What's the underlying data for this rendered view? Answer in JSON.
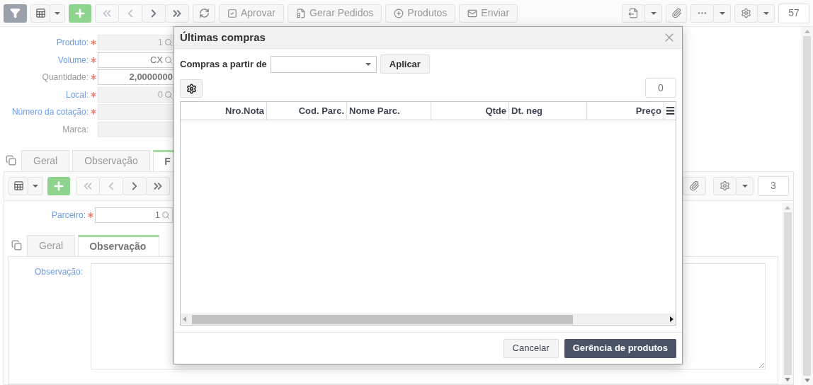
{
  "toolbar": {
    "navigation": [
      {
        "disabled": true
      },
      {
        "disabled": true
      },
      {
        "disabled": false
      },
      {
        "disabled": false
      }
    ],
    "actions": [
      {
        "label": "Aprovar"
      },
      {
        "label": "Gerar Pedidos"
      },
      {
        "label": "Produtos"
      },
      {
        "label": "Enviar"
      }
    ],
    "record_count": "57"
  },
  "form": {
    "fields": [
      {
        "label": "Produto:",
        "required": true,
        "linked": true,
        "value": "1",
        "lookup": true,
        "disabled": true
      },
      {
        "label": "Volume:",
        "required": true,
        "linked": true,
        "value": "CX",
        "lookup": true,
        "disabled": false
      },
      {
        "label": "Quantidade:",
        "required": true,
        "linked": false,
        "value": "2,0000000",
        "lookup": false,
        "disabled": false
      },
      {
        "label": "Local:",
        "required": true,
        "linked": true,
        "value": "0",
        "lookup": true,
        "disabled": true
      },
      {
        "label": "Número da cotação:",
        "required": true,
        "linked": true,
        "lookup": false,
        "disabled": true
      },
      {
        "label": "Marca:",
        "required": false,
        "linked": false,
        "lookup": false,
        "disabled": true
      }
    ]
  },
  "tabs": [
    {
      "label": "Geral",
      "selected": false
    },
    {
      "label": "Observação",
      "selected": false
    },
    {
      "label": "F",
      "selected": true
    }
  ],
  "detail": {
    "navigation": [
      {
        "disabled": true
      },
      {
        "disabled": true
      },
      {
        "disabled": false
      },
      {
        "disabled": false
      }
    ],
    "record_count": "3",
    "fields": [
      {
        "label": "Parceiro:",
        "required": true,
        "linked": true,
        "value": "1",
        "lookup": true,
        "disabled": false
      }
    ],
    "tabs": [
      {
        "label": "Geral",
        "selected": false
      },
      {
        "label": "Observação",
        "selected": true
      }
    ],
    "note_field": {
      "label": "Observação:"
    }
  },
  "dialog": {
    "title": "Últimas compras",
    "filter_label": "Compras a partir de",
    "apply_button": "Aplicar",
    "record_count": "0",
    "columns": [
      {
        "label": "Nro.Nota"
      },
      {
        "label": "Cod. Parc."
      },
      {
        "label": "Nome Parc."
      },
      {
        "label": "Qtde"
      },
      {
        "label": "Dt. neg"
      },
      {
        "label": "Preço"
      }
    ],
    "buttons": [
      {
        "label": "Cancelar",
        "kind": "secondary"
      },
      {
        "label": "Gerência de produtos",
        "kind": "primary"
      }
    ]
  }
}
